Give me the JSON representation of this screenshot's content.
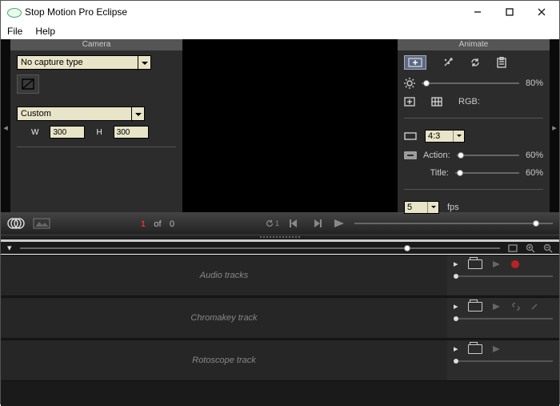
{
  "window": {
    "title": "Stop Motion Pro Eclipse"
  },
  "menu": {
    "file": "File",
    "help": "Help"
  },
  "camera": {
    "header": "Camera",
    "capture_type": "No capture type",
    "preset": "Custom",
    "w_label": "W",
    "w_value": "300",
    "h_label": "H",
    "h_value": "300"
  },
  "animate": {
    "header": "Animate",
    "opacity_pct": "80%",
    "rgb_label": "RGB:",
    "aspect": "4:3",
    "action_label": "Action:",
    "action_pct": "60%",
    "title_label": "Title:",
    "title_pct": "60%",
    "fps_value": "5",
    "fps_label": "fps"
  },
  "playbar": {
    "current": "1",
    "of": "of",
    "total": "0",
    "loop_count": "1"
  },
  "tracks": {
    "audio": "Audio tracks",
    "chroma": "Chromakey track",
    "roto": "Rotoscope track"
  }
}
